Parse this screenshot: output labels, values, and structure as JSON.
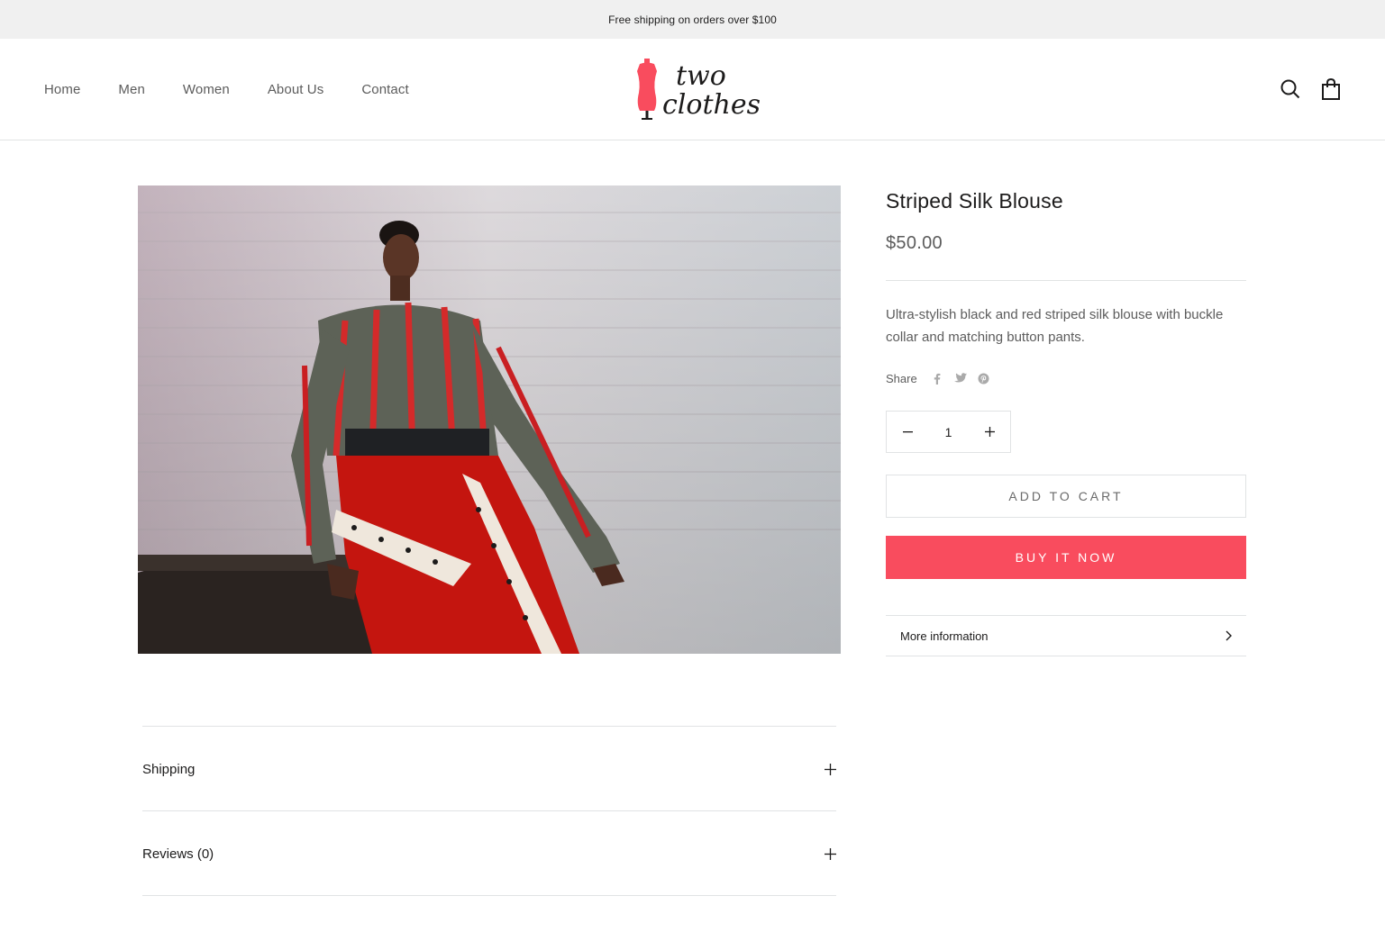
{
  "announcement": "Free shipping on orders over $100",
  "nav": [
    "Home",
    "Men",
    "Women",
    "About Us",
    "Contact"
  ],
  "logo": {
    "line1": "two",
    "line2": "clothes",
    "accent": "#f94c5e"
  },
  "product": {
    "title": "Striped Silk Blouse",
    "price": "$50.00",
    "description": "Ultra-stylish black and red striped silk blouse with buckle collar and matching button pants.",
    "share_label": "Share",
    "share_icons": [
      "facebook-icon",
      "twitter-icon",
      "pinterest-icon"
    ],
    "quantity": "1",
    "add_to_cart": "ADD TO CART",
    "buy_now": "BUY IT NOW",
    "more_info": "More information"
  },
  "tabs": {
    "shipping": "Shipping",
    "reviews": "Reviews (0)"
  },
  "colors": {
    "brand": "#f94c5e",
    "text_dark": "#1c1b1b",
    "text": "#5c5c5c",
    "border": "#e1e3e4",
    "announcement_bg": "#f0f0f0"
  }
}
